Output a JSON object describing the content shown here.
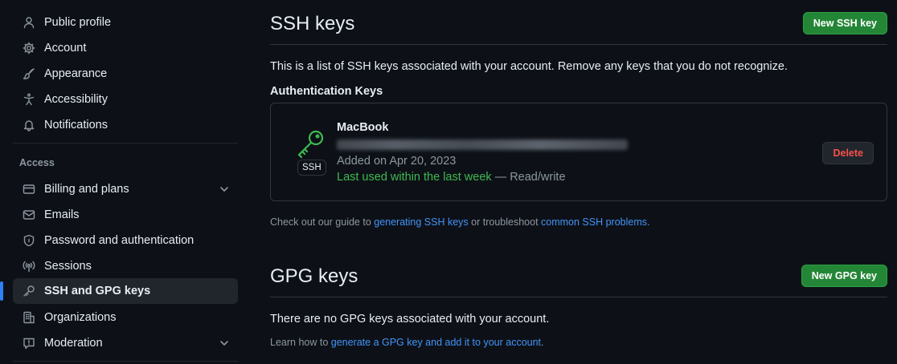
{
  "sidebar": {
    "items": [
      {
        "label": "Public profile",
        "icon": "person-icon"
      },
      {
        "label": "Account",
        "icon": "gear-icon"
      },
      {
        "label": "Appearance",
        "icon": "paintbrush-icon"
      },
      {
        "label": "Accessibility",
        "icon": "accessibility-icon"
      },
      {
        "label": "Notifications",
        "icon": "bell-icon"
      }
    ],
    "access_heading": "Access",
    "access_items": [
      {
        "label": "Billing and plans",
        "icon": "credit-card-icon",
        "expandable": true
      },
      {
        "label": "Emails",
        "icon": "mail-icon"
      },
      {
        "label": "Password and authentication",
        "icon": "shield-lock-icon"
      },
      {
        "label": "Sessions",
        "icon": "broadcast-icon"
      },
      {
        "label": "SSH and GPG keys",
        "icon": "key-icon",
        "active": true
      },
      {
        "label": "Organizations",
        "icon": "organization-icon"
      },
      {
        "label": "Moderation",
        "icon": "report-icon",
        "expandable": true
      }
    ]
  },
  "ssh": {
    "title": "SSH keys",
    "new_button": "New SSH key",
    "description": "This is a list of SSH keys associated with your account. Remove any keys that you do not recognize.",
    "auth_heading": "Authentication Keys",
    "key": {
      "name": "MacBook",
      "badge": "SSH",
      "added": "Added on Apr 20, 2023",
      "last_used": "Last used within the last week",
      "access": " — Read/write",
      "delete_label": "Delete"
    },
    "guide_prefix": "Check out our guide to ",
    "guide_link": "generating SSH keys",
    "guide_middle": " or troubleshoot ",
    "guide_link2": "common SSH problems",
    "guide_suffix": "."
  },
  "gpg": {
    "title": "GPG keys",
    "new_button": "New GPG key",
    "empty": "There are no GPG keys associated with your account.",
    "learn_prefix": "Learn how to ",
    "learn_link": "generate a GPG key and add it to your account",
    "learn_suffix": "."
  },
  "colors": {
    "background": "#0d1117",
    "accent_blue": "#2f81f7",
    "green_button": "#238636",
    "success_text": "#3fb950",
    "danger_text": "#f85149"
  }
}
